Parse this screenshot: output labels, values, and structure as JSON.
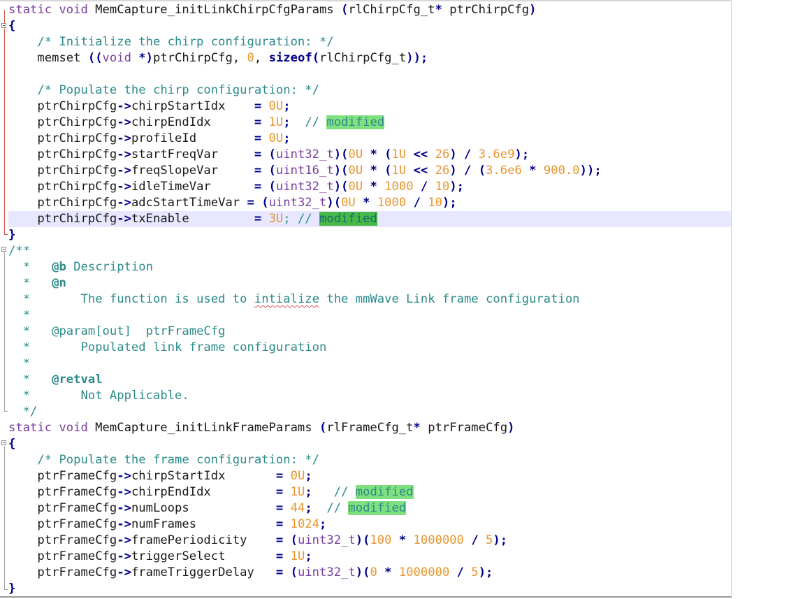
{
  "code": {
    "fn1_sig": {
      "a": "static void",
      "b": " MemCapture_initLinkChirpCfgParams ",
      "c": "(",
      "d": "rlChirpCfg_t",
      "e": "*",
      "f": " ptrChirpCfg",
      "g": ")"
    },
    "brace_open": "{",
    "brace_close": "}",
    "c_init": "/* Initialize the chirp configuration: */",
    "memset": {
      "a": "memset ",
      "b": "((",
      "c": "void",
      "d": " *)",
      "e": "ptrChirpCfg, ",
      "f": "0",
      "g": ", ",
      "h": "sizeof",
      "i": "(",
      "j": "rlChirpCfg_t",
      "k": "));"
    },
    "c_populate_chirp": "/* Populate the chirp configuration: */",
    "chirp": {
      "l1": {
        "a": "ptrChirpCfg",
        "b": "->",
        "c": "chirpStartIdx    ",
        "d": "= ",
        "e": "0U",
        "f": ";"
      },
      "l2": {
        "a": "ptrChirpCfg",
        "b": "->",
        "c": "chirpEndIdx      ",
        "d": "= ",
        "e": "1U",
        "f": ";  ",
        "g": "// ",
        "h": "modified"
      },
      "l3": {
        "a": "ptrChirpCfg",
        "b": "->",
        "c": "profileId        ",
        "d": "= ",
        "e": "0U",
        "f": ";"
      },
      "l4": {
        "a": "ptrChirpCfg",
        "b": "->",
        "c": "startFreqVar     ",
        "d": "= (",
        "e": "uint32_t",
        "f": ")(",
        "g": "0U",
        "h": " * (",
        "i": "1U",
        "j": " << ",
        "k": "26",
        "l": ") / ",
        "m": "3.6e9",
        "n": ");"
      },
      "l5": {
        "a": "ptrChirpCfg",
        "b": "->",
        "c": "freqSlopeVar     ",
        "d": "= (",
        "e": "uint16_t",
        "f": ")(",
        "g": "0U",
        "h": " * (",
        "i": "1U",
        "j": " << ",
        "k": "26",
        "l": ") / (",
        "m": "3.6e6",
        "n": " * ",
        "o": "900.0",
        "p": "));"
      },
      "l6": {
        "a": "ptrChirpCfg",
        "b": "->",
        "c": "idleTimeVar      ",
        "d": "= (",
        "e": "uint32_t",
        "f": ")(",
        "g": "0U",
        "h": " * ",
        "i": "1000",
        "j": " / ",
        "k": "10",
        "l": ");"
      },
      "l7": {
        "a": "ptrChirpCfg",
        "b": "->",
        "c": "adcStartTimeVar ",
        "d": "= (",
        "e": "uint32_t",
        "f": ")(",
        "g": "0U",
        "h": " * ",
        "i": "1000",
        "j": " / ",
        "k": "10",
        "l": ");"
      },
      "l8": {
        "a": "ptrChirpCfg",
        "b": "->",
        "c": "txEnable         ",
        "d": "= ",
        "e": "3U",
        "f": "; // ",
        "g": "modified"
      }
    },
    "doc": {
      "open": "/**",
      "star": "*",
      "b_tag": "@b",
      "b_text": " Description",
      "n_tag": "@n",
      "desc_pre": "The function is used to ",
      "desc_err": "intialize",
      "desc_post": " the mmWave Link frame configuration",
      "param": "@param[out]  ptrFrameCfg",
      "param_desc": "Populated link frame configuration",
      "retval": "@retval",
      "retval_desc": "Not Applicable.",
      "close": "*/"
    },
    "fn2_sig": {
      "a": "static void",
      "b": " MemCapture_initLinkFrameParams ",
      "c": "(",
      "d": "rlFrameCfg_t",
      "e": "*",
      "f": " ptrFrameCfg",
      "g": ")"
    },
    "c_populate_frame": "/* Populate the frame configuration: */",
    "frame": {
      "l1": {
        "a": "ptrFrameCfg",
        "b": "->",
        "c": "chirpStartIdx       ",
        "d": "= ",
        "e": "0U",
        "f": ";"
      },
      "l2": {
        "a": "ptrFrameCfg",
        "b": "->",
        "c": "chirpEndIdx         ",
        "d": "= ",
        "e": "1U",
        "f": ";   ",
        "g": "// ",
        "h": "modified"
      },
      "l3": {
        "a": "ptrFrameCfg",
        "b": "->",
        "c": "numLoops            ",
        "d": "= ",
        "e": "44",
        "f": ";  ",
        "g": "// ",
        "h": "modified"
      },
      "l4": {
        "a": "ptrFrameCfg",
        "b": "->",
        "c": "numFrames           ",
        "d": "= ",
        "e": "1024",
        "f": ";"
      },
      "l5": {
        "a": "ptrFrameCfg",
        "b": "->",
        "c": "framePeriodicity    ",
        "d": "= (",
        "e": "uint32_t",
        "f": ")(",
        "g": "100",
        "h": " * ",
        "i": "1000000",
        "j": " / ",
        "k": "5",
        "l": ");"
      },
      "l6": {
        "a": "ptrFrameCfg",
        "b": "->",
        "c": "triggerSelect       ",
        "d": "= ",
        "e": "1U",
        "f": ";"
      },
      "l7": {
        "a": "ptrFrameCfg",
        "b": "->",
        "c": "frameTriggerDelay   ",
        "d": "= (",
        "e": "uint32_t",
        "f": ")(",
        "g": "0",
        "h": " * ",
        "i": "1000000",
        "j": " / ",
        "k": "5",
        "l": ");"
      }
    }
  }
}
